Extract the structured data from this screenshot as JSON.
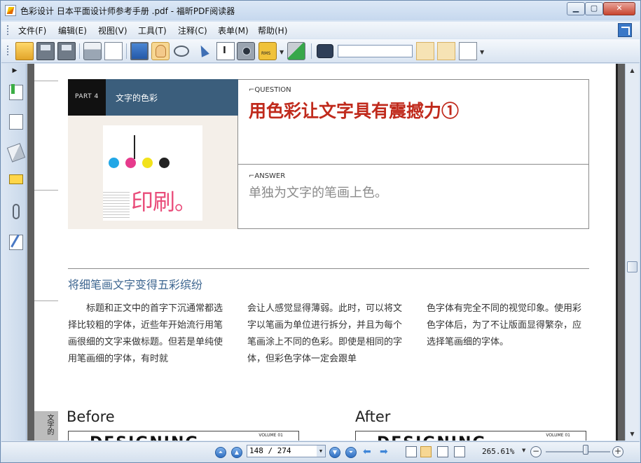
{
  "window": {
    "title": "色彩设计 日本平面设计师参考手册 .pdf - 福昕PDF阅读器",
    "minimize": "▁",
    "maximize": "▢",
    "close": "✕"
  },
  "menu": {
    "items": [
      {
        "label": "文件(F)"
      },
      {
        "label": "编辑(E)"
      },
      {
        "label": "视图(V)"
      },
      {
        "label": "工具(T)"
      },
      {
        "label": "注释(C)"
      },
      {
        "label": "表单(M)"
      },
      {
        "label": "帮助(H)"
      }
    ]
  },
  "toolbar": {
    "icons": [
      "open-folder-icon",
      "save-icon",
      "save-as-icon",
      "print-icon",
      "scan-icon",
      "fullscreen-icon",
      "hand-tool-icon",
      "zoom-glass-icon",
      "select-arrow-icon",
      "text-select-icon",
      "snapshot-camera-icon",
      "rms-lock-icon",
      "sign-icon",
      "find-binoculars-icon",
      "find-prev-icon",
      "find-next-icon",
      "highlight-icon"
    ],
    "rms_label": "RMS",
    "search_value": ""
  },
  "left_panel": {
    "toggle": "▶",
    "icons": [
      "bookmark-icon",
      "pages-icon",
      "layers-icon",
      "comments-icon",
      "attachments-icon",
      "signatures-icon"
    ]
  },
  "document": {
    "part_label": "PART 4",
    "part_title": "文字的色彩",
    "hero_text": "印刷。",
    "question_label": "⌐QUESTION",
    "question_title": "用色彩让文字具有震撼力①",
    "answer_label": "⌐ANSWER",
    "answer_text": "单独为文字的笔画上色。",
    "section_title": "将细笔画文字变得五彩缤纷",
    "paragraphs": [
      "标题和正文中的首字下沉通常都选择比较粗的字体，近些年开始流行用笔画很细的文字来做标题。但若是单纯使用笔画细的字体，有时就",
      "会让人感觉显得薄弱。此时，可以将文字以笔画为单位进行拆分，并且为每个笔画涂上不同的色彩。即使是相同的字体，但彩色字体一定会跟单",
      "色字体有完全不同的视觉印象。使用彩色字体后，为了不让版面显得繁杂，应选择笔画细的字体。"
    ],
    "before_label": "Before",
    "after_label": "After",
    "box_logo": "DESIGNING",
    "box_vol": "VOLUME 01",
    "side_tab": "文字的"
  },
  "status": {
    "page_value": "148 / 274",
    "zoom": "265.61%",
    "zoom_level": 0.62
  },
  "colors": {
    "title_red": "#c02a1c",
    "section_blue": "#3d6690",
    "hero_bar": "#3b5e7c"
  }
}
